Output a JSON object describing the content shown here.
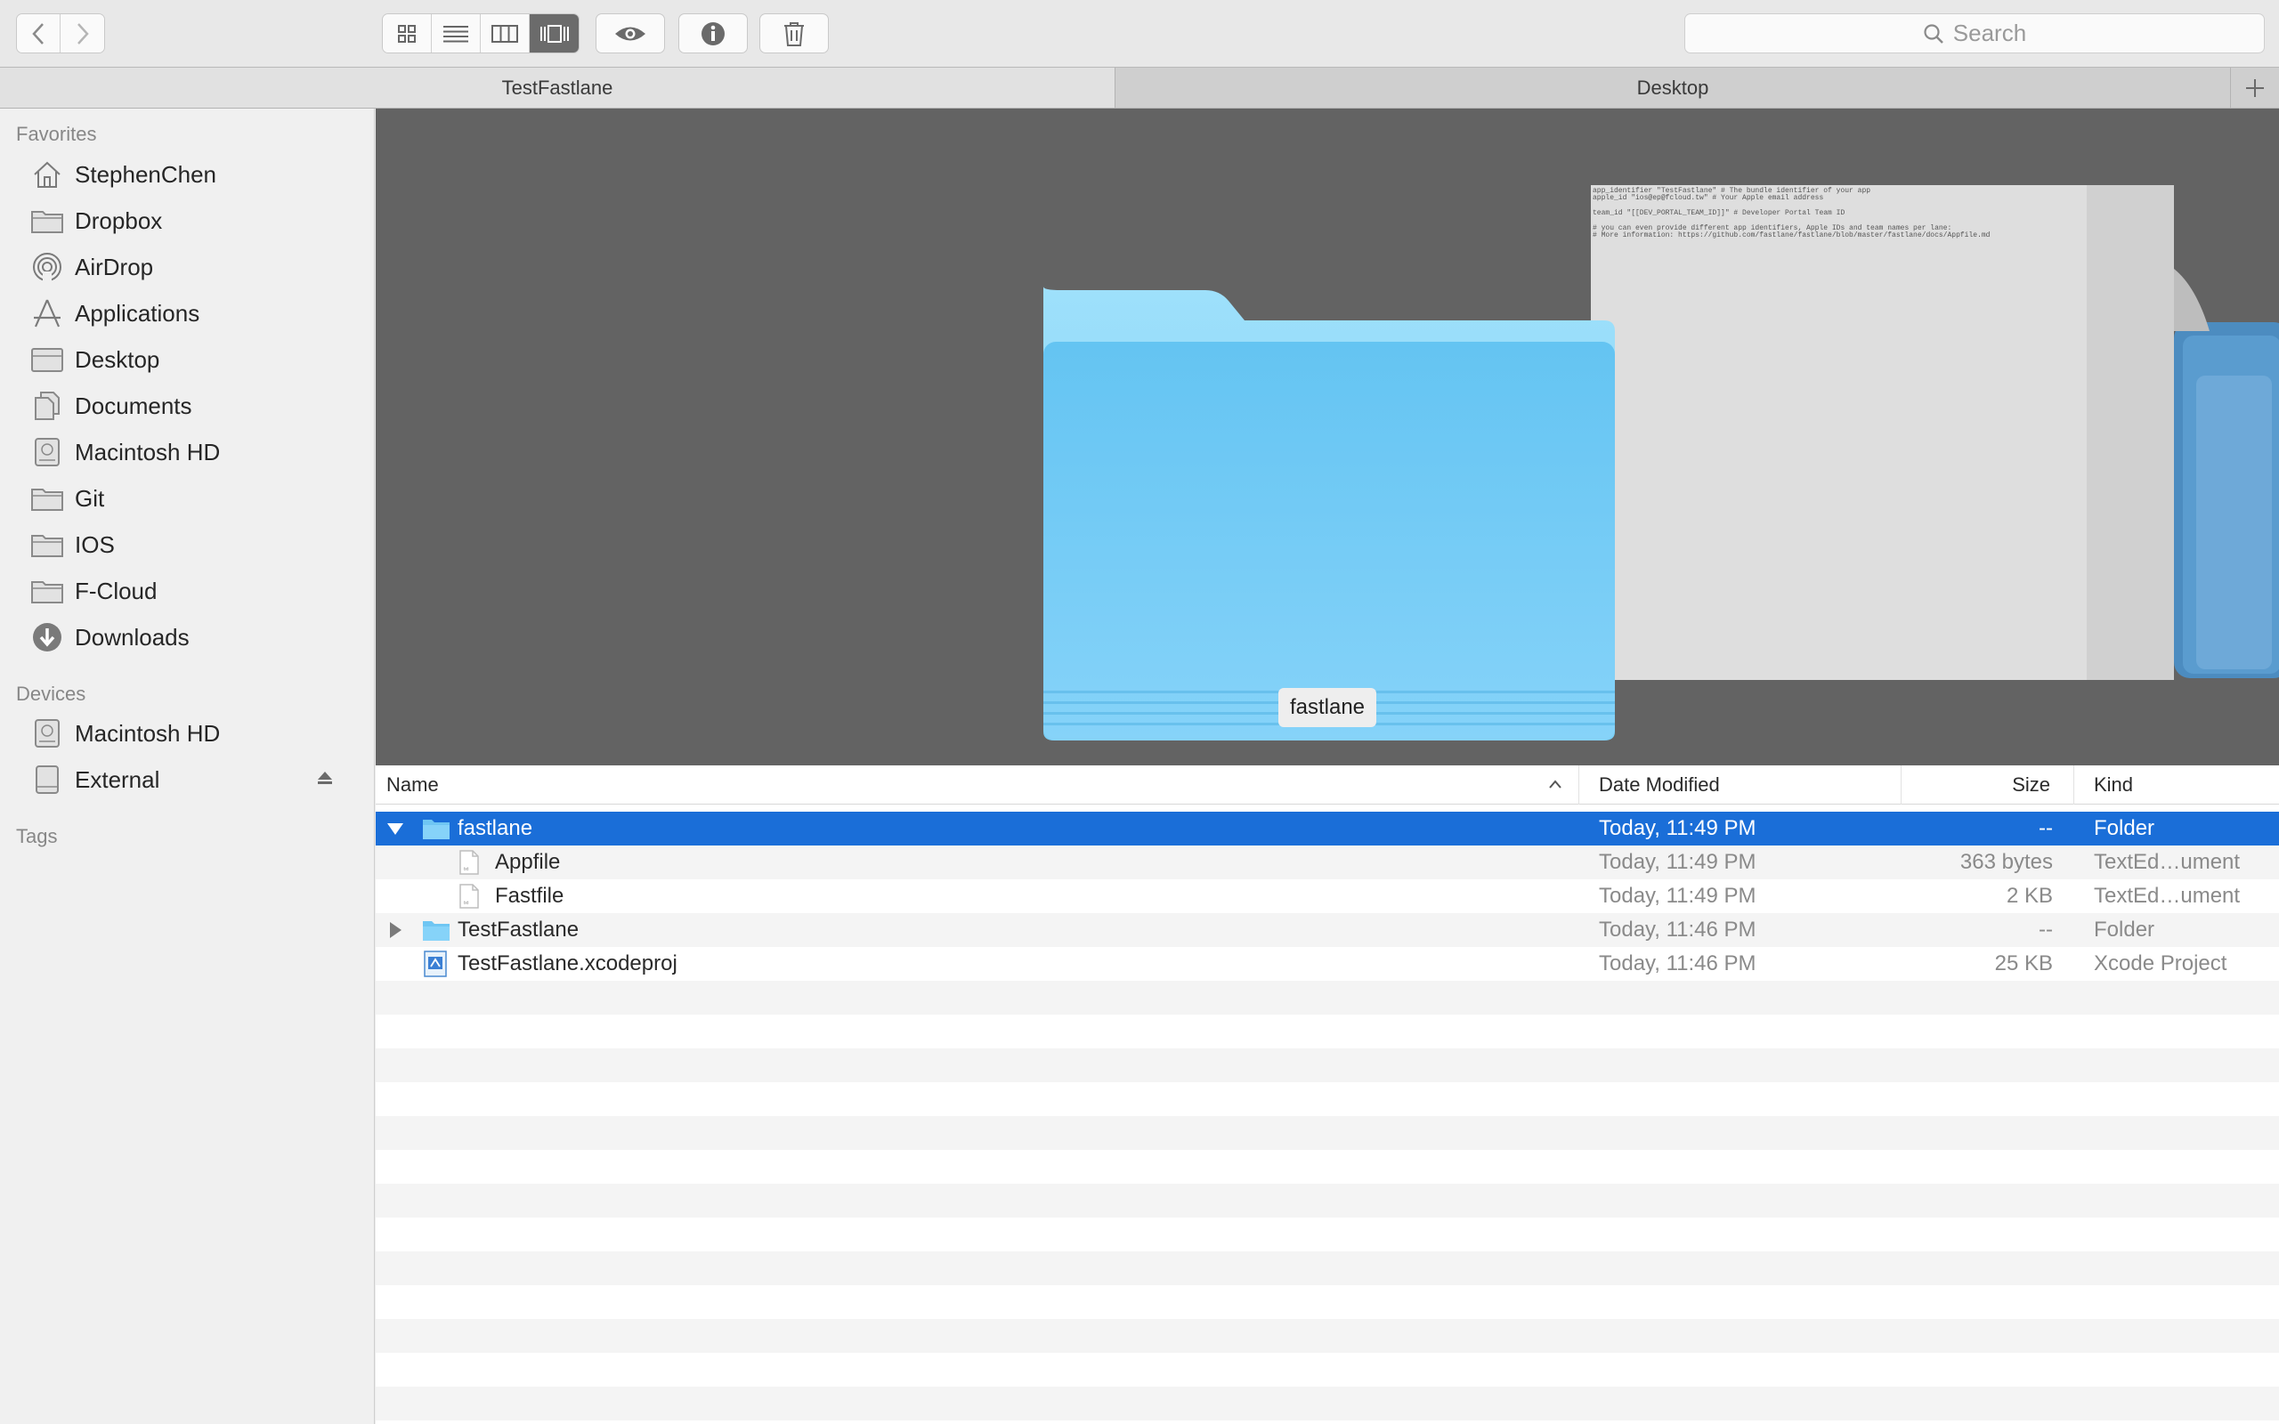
{
  "toolbar": {
    "back_icon": "chevron-left-icon",
    "forward_icon": "chevron-right-icon",
    "view_modes": [
      "icon-view",
      "list-view",
      "column-view",
      "cover-flow-view"
    ],
    "active_view": "cover-flow-view",
    "quicklook_icon": "eye-icon",
    "info_icon": "info-icon",
    "trash_icon": "trash-icon",
    "search_placeholder": "Search"
  },
  "tabs": [
    {
      "label": "TestFastlane",
      "active": true
    },
    {
      "label": "Desktop",
      "active": false
    }
  ],
  "sidebar": {
    "favorites_heading": "Favorites",
    "favorites": [
      {
        "label": "StephenChen",
        "icon": "home-icon"
      },
      {
        "label": "Dropbox",
        "icon": "folder-icon"
      },
      {
        "label": "AirDrop",
        "icon": "airdrop-icon"
      },
      {
        "label": "Applications",
        "icon": "applications-icon"
      },
      {
        "label": "Desktop",
        "icon": "desktop-folder-icon"
      },
      {
        "label": "Documents",
        "icon": "documents-folder-icon"
      },
      {
        "label": "Macintosh HD",
        "icon": "hard-drive-icon"
      },
      {
        "label": "Git",
        "icon": "folder-icon"
      },
      {
        "label": "IOS",
        "icon": "folder-icon"
      },
      {
        "label": "F-Cloud",
        "icon": "folder-icon"
      },
      {
        "label": "Downloads",
        "icon": "downloads-icon"
      }
    ],
    "devices_heading": "Devices",
    "devices": [
      {
        "label": "Macintosh HD",
        "icon": "hard-drive-icon"
      },
      {
        "label": "External",
        "icon": "external-drive-icon"
      }
    ],
    "tags_heading": "Tags"
  },
  "preview": {
    "selected_name": "fastlane",
    "doc_text_lines": [
      "app_identifier \"TestFastlane\" # The bundle identifier of your app",
      "apple_id \"ios@ep@fcloud.tw\" # Your Apple email address",
      "",
      "team_id \"[[DEV_PORTAL_TEAM_ID]]\"  # Developer Portal Team ID",
      "",
      "# you can even provide different app identifiers, Apple IDs and team names per lane:",
      "# More information: https://github.com/fastlane/fastlane/blob/master/fastlane/docs/Appfile.md"
    ]
  },
  "list": {
    "columns": {
      "name": "Name",
      "date": "Date Modified",
      "size": "Size",
      "kind": "Kind"
    },
    "rows": [
      {
        "name": "fastlane",
        "date": "Today, 11:49 PM",
        "size": "--",
        "kind": "Folder",
        "icon": "folder-icon",
        "disclosure": "expanded",
        "indent": 0,
        "selected": true
      },
      {
        "name": "Appfile",
        "date": "Today, 11:49 PM",
        "size": "363 bytes",
        "kind": "TextEd…ument",
        "icon": "text-file-icon",
        "disclosure": "",
        "indent": 1,
        "selected": false
      },
      {
        "name": "Fastfile",
        "date": "Today, 11:49 PM",
        "size": "2 KB",
        "kind": "TextEd…ument",
        "icon": "text-file-icon",
        "disclosure": "",
        "indent": 1,
        "selected": false
      },
      {
        "name": "TestFastlane",
        "date": "Today, 11:46 PM",
        "size": "--",
        "kind": "Folder",
        "icon": "folder-icon",
        "disclosure": "collapsed",
        "indent": 0,
        "selected": false
      },
      {
        "name": "TestFastlane.xcodeproj",
        "date": "Today, 11:46 PM",
        "size": "25 KB",
        "kind": "Xcode Project",
        "icon": "xcode-project-icon",
        "disclosure": "",
        "indent": 0,
        "selected": false
      }
    ]
  },
  "colors": {
    "selection": "#1a6ed8",
    "folder_blue": "#6cc8f5",
    "preview_bg": "#636363"
  }
}
